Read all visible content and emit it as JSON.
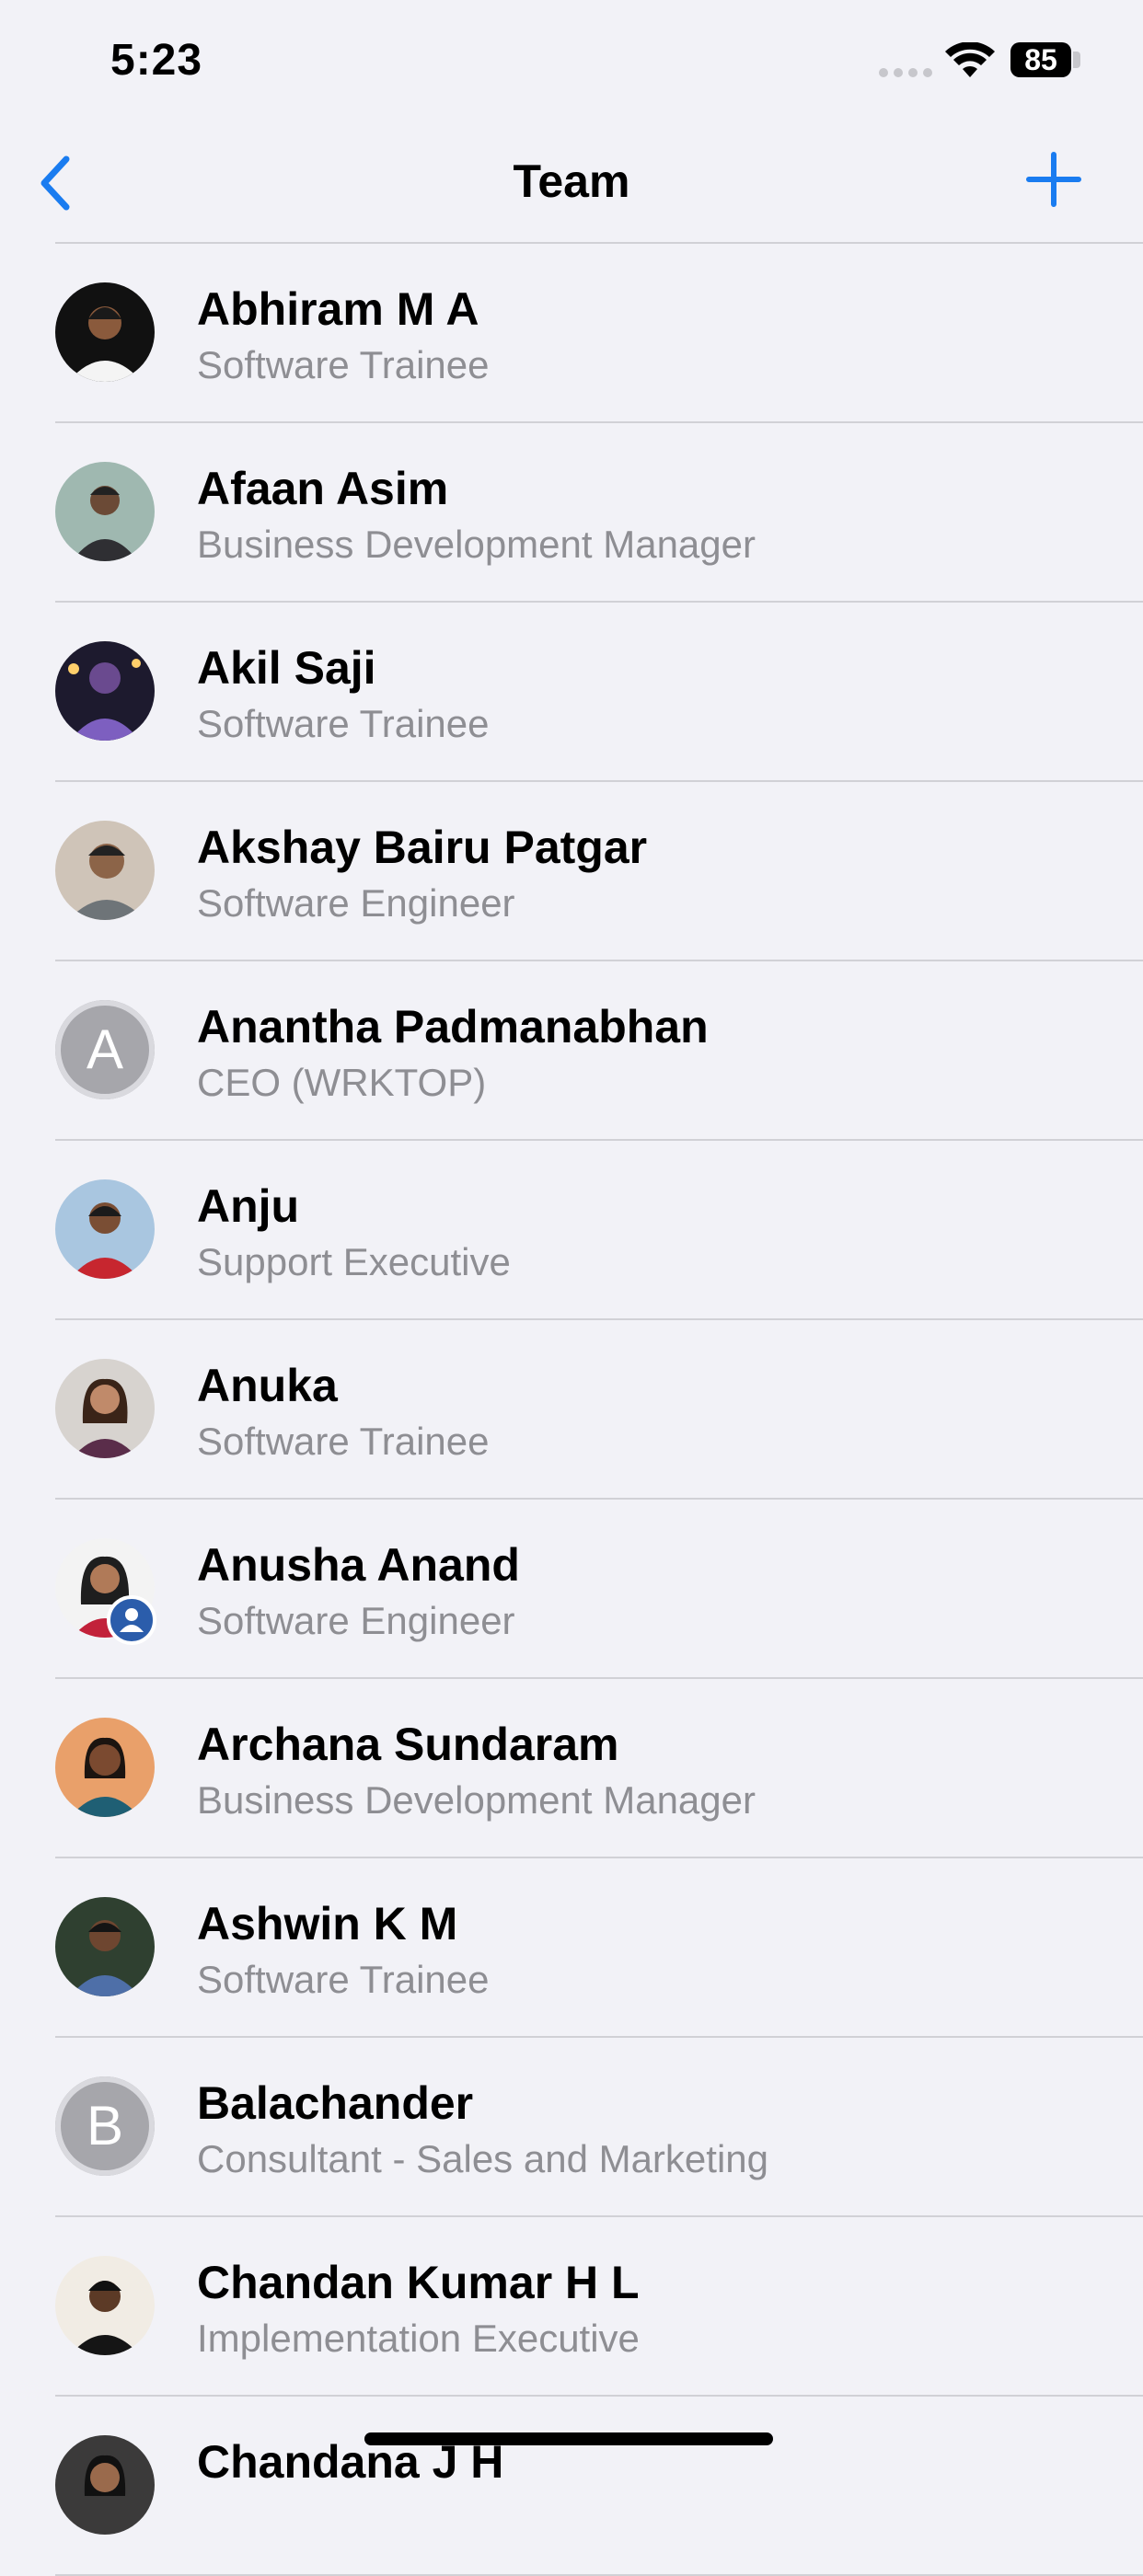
{
  "status_bar": {
    "time": "5:23",
    "battery": "85"
  },
  "nav": {
    "title": "Team",
    "back_icon": "chevron-left-icon",
    "add_icon": "plus-icon",
    "accent": "#1a7cf0"
  },
  "members": [
    {
      "name": "Abhiram M A",
      "role": "Software Trainee",
      "avatar": "photo"
    },
    {
      "name": "Afaan Asim",
      "role": "Business Development Manager",
      "avatar": "photo"
    },
    {
      "name": "Akil Saji",
      "role": "Software Trainee",
      "avatar": "photo"
    },
    {
      "name": "Akshay Bairu Patgar",
      "role": "Software Engineer",
      "avatar": "photo"
    },
    {
      "name": "Anantha Padmanabhan",
      "role": "CEO (WRKTOP)",
      "avatar": "A"
    },
    {
      "name": "Anju",
      "role": "Support Executive",
      "avatar": "photo"
    },
    {
      "name": "Anuka",
      "role": "Software Trainee",
      "avatar": "photo"
    },
    {
      "name": "Anusha Anand",
      "role": "Software Engineer",
      "avatar": "photo"
    },
    {
      "name": "Archana Sundaram",
      "role": "Business Development Manager",
      "avatar": "photo"
    },
    {
      "name": "Ashwin K M",
      "role": "Software Trainee",
      "avatar": "photo"
    },
    {
      "name": "Balachander",
      "role": "Consultant - Sales and Marketing",
      "avatar": "B"
    },
    {
      "name": "Chandan Kumar H L",
      "role": "Implementation Executive",
      "avatar": "photo"
    },
    {
      "name": "Chandana J H",
      "role": "",
      "avatar": "photo"
    }
  ]
}
